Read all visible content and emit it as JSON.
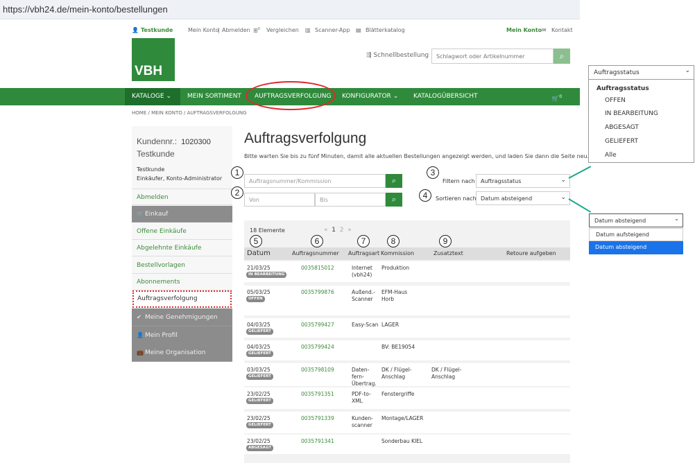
{
  "browser": {
    "url": "https://vbh24.de/mein-konto/bestellungen"
  },
  "topbar": {
    "user": "Testkunde",
    "account": "Mein Konto",
    "sep": "|",
    "logout": "Abmelden",
    "compare": "Vergleichen",
    "compare_count": "0",
    "scanner": "Scanner-App",
    "catalog": "Blätterkatalog",
    "my_account": "Mein Konto",
    "contact": "Kontakt"
  },
  "header": {
    "logo": "VBH",
    "quick_order": "Schnellbestellung",
    "search_placeholder": "Schlagwort oder Artikelnummer"
  },
  "nav": {
    "items": [
      "KATALOGE",
      "MEIN SORTIMENT",
      "AUFTRAGSVERFOLGUNG",
      "KONFIGURATOR",
      "KATALOGÜBERSICHT"
    ],
    "cart_count": "0"
  },
  "breadcrumb": {
    "home": "HOME",
    "konto": "MEIN KONTO",
    "current": "AUFTRAGSVERFOLGUNG",
    "sep": "/"
  },
  "sidebar": {
    "customer_label": "Kundennr.:",
    "customer_no": "1020300",
    "customer_name": "Testkunde",
    "role_name": "Testkunde",
    "role_desc": "Einkäufer, Konto-Administrator",
    "items": [
      "Abmelden",
      "Einkauf",
      "Offene Einkäufe",
      "Abgelehnte Einkäufe",
      "Bestellvorlagen",
      "Abonnements",
      "Auftragsverfolgung",
      "Meine Genehmigungen",
      "Mein Profil",
      "Meine Organisation"
    ]
  },
  "main": {
    "title": "Auftragsverfolgung",
    "hint": "Bitte warten Sie bis zu fünf Minuten, damit alle aktuellen Bestellungen angezeigt werden, und laden Sie dann die Seite neu.",
    "order_placeholder": "Auftragsnummer/Kommission",
    "from_placeholder": "Von",
    "to_placeholder": "Bis",
    "filter_label": "Filtern nach",
    "filter_value": "Auftragsstatus",
    "sort_label": "Sortieren nach",
    "sort_value": "Datum absteigend",
    "count": "18 Elemente",
    "pager": {
      "prev": "«",
      "p1": "1",
      "p2": "2",
      "next": "»"
    },
    "columns": [
      "Datum",
      "Auftragsnummer",
      "Auftragsart",
      "Kommission",
      "Zusatztext",
      "Retoure aufgeben"
    ],
    "annotations": [
      "1",
      "2",
      "3",
      "4",
      "5",
      "6",
      "7",
      "8",
      "9"
    ],
    "rows": [
      {
        "date": "21/03/25",
        "status": "IN BEARBEITUNG",
        "order": "0035815012",
        "type": "Internet\n(vbh24)",
        "commission": "Produktion",
        "extra": ""
      },
      {
        "date": "05/03/25",
        "status": "OFFEN",
        "order": "0035799876",
        "type": "Außend.-\nScanner",
        "commission": "EFM-Haus\nHorb",
        "extra": ""
      },
      {
        "date": "04/03/25",
        "status": "GELIEFERT",
        "order": "0035799427",
        "type": "Easy-Scan",
        "commission": "LAGER",
        "extra": ""
      },
      {
        "date": "04/03/25",
        "status": "GELIEFERT",
        "order": "0035799424",
        "type": "",
        "commission": "BV: BE19054",
        "extra": ""
      },
      {
        "date": "03/03/25",
        "status": "GELIEFERT",
        "order": "0035798109",
        "type": "Daten-\nfern-\nÜbertrag.",
        "commission": "DK / Flügel-\nAnschlag",
        "extra": "DK / Flügel-\nAnschlag"
      },
      {
        "date": "23/02/25",
        "status": "GELIEFERT",
        "order": "0035791351",
        "type": "PDF-to-\nXML",
        "commission": "Fenstergriffe",
        "extra": ""
      },
      {
        "date": "23/02/25",
        "status": "GELIEFERT",
        "order": "0035791339",
        "type": "Kunden-\nscanner",
        "commission": "Montage/LAGER",
        "extra": ""
      },
      {
        "date": "23/02/25",
        "status": "ABGESAGT",
        "order": "0035791341",
        "type": "",
        "commission": "Sonderbau KIEL",
        "extra": ""
      }
    ]
  },
  "status_dropdown": {
    "selected": "Auftragsstatus",
    "group": "Auftragsstatus",
    "options": [
      "OFFEN",
      "IN BEARBEITUNG",
      "ABGESAGT",
      "GELIEFERT",
      "Alle"
    ]
  },
  "sort_dropdown": {
    "selected": "Datum absteigend",
    "options": [
      "Datum aufsteigend",
      "Datum absteigend"
    ]
  },
  "colors": {
    "brand_green": "#2f8a3c",
    "highlight_red": "#e0282c",
    "connector": "#16a88a",
    "select_blue": "#1a73e8"
  },
  "icons": [
    "user-icon",
    "compare-icon",
    "scanner-icon",
    "catalog-icon",
    "mail-icon",
    "search-icon",
    "cart-icon",
    "chevron-down-icon",
    "check-icon",
    "cart-small-icon"
  ]
}
